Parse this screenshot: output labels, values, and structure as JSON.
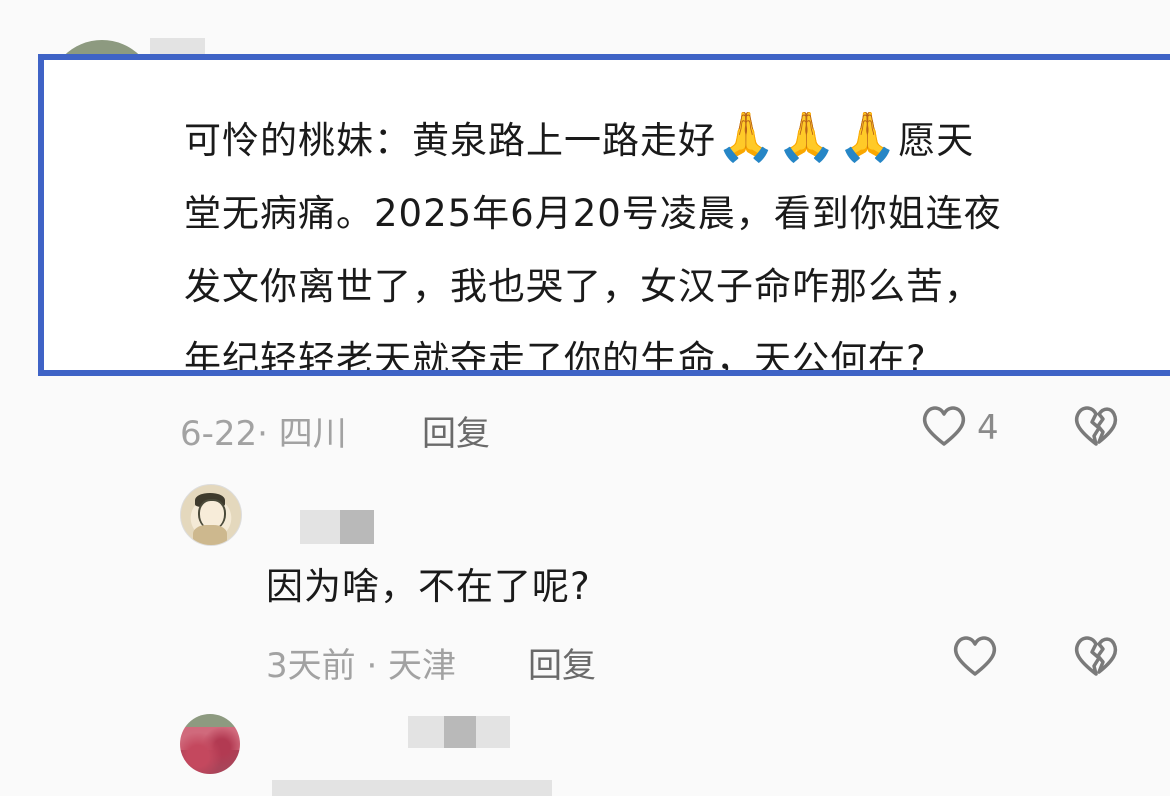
{
  "comments": [
    {
      "text_parts": [
        "可怜的桃妹：黄泉路上一路走好",
        "愿天",
        "堂无病痛。2025年6月20号凌晨，看到你姐连夜",
        "发文你离世了，我也哭了，女汉子命咋那么苦，",
        "年纪轻轻老天就夺走了你的生命，天公何在?"
      ],
      "emoji": "🙏",
      "date": "6-22",
      "location": "· 四川",
      "reply_label": "回复",
      "like_count": "4"
    },
    {
      "text": "因为啥，不在了呢?",
      "meta": "3天前 · 天津",
      "reply_label": "回复"
    }
  ],
  "colors": {
    "highlight_border": "#3f63c6",
    "meta_text": "#a2a2a2",
    "reply_text": "#6a6a6a"
  },
  "icons": [
    "heart-icon",
    "broken-heart-icon",
    "pray-emoji"
  ]
}
